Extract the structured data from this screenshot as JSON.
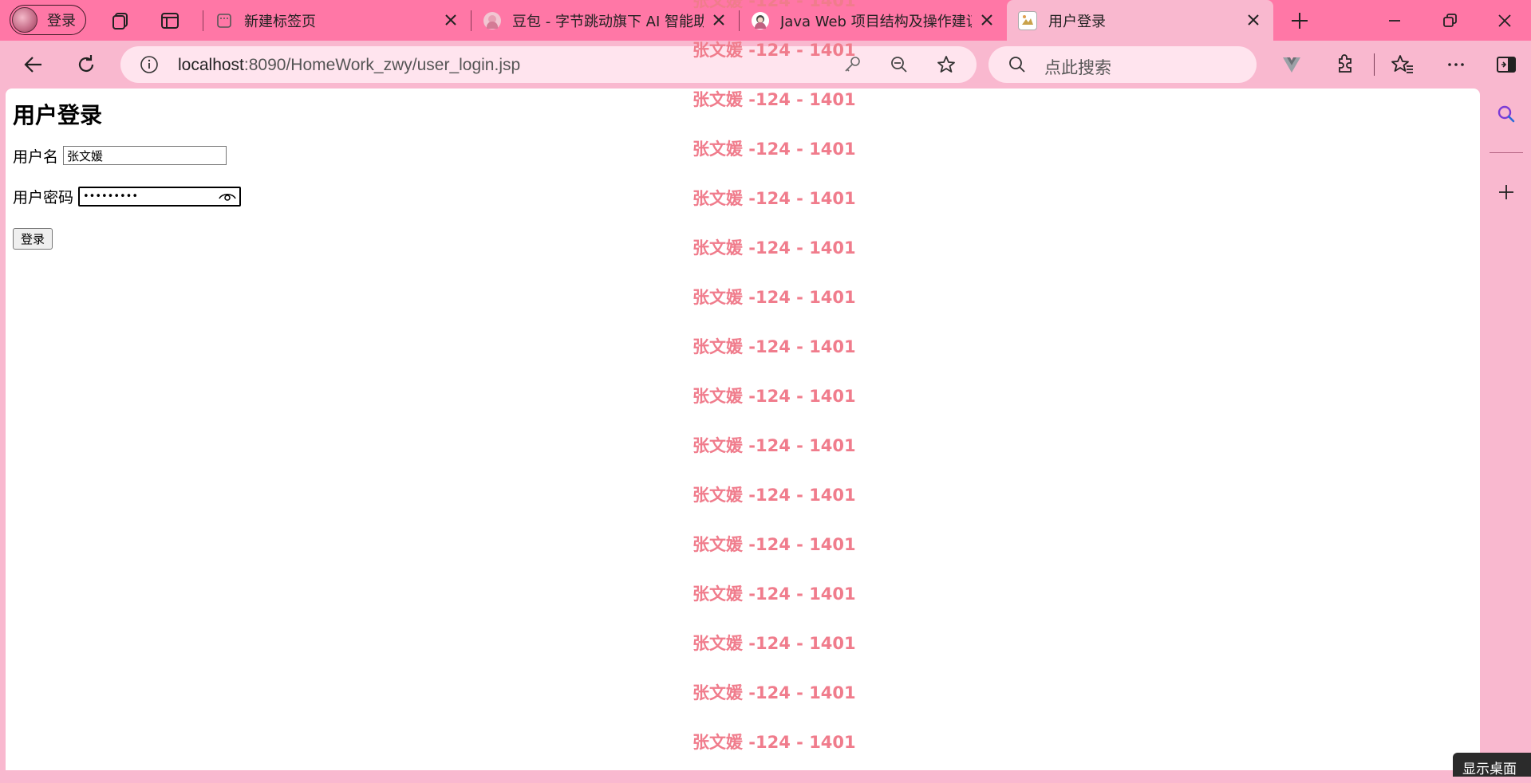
{
  "browser": {
    "profile_label": "登录",
    "tabs": [
      {
        "title": "新建标签页",
        "active": false
      },
      {
        "title": "豆包 - 字节跳动旗下 AI 智能助",
        "active": false
      },
      {
        "title": "Java Web 项目结构及操作建议",
        "active": false
      },
      {
        "title": "用户登录",
        "active": true
      }
    ],
    "address": {
      "host": "localhost",
      "rest": ":8090/HomeWork_zwy/user_login.jsp"
    },
    "search_placeholder": "点此搜索"
  },
  "page": {
    "title": "用户登录",
    "username_label": "用户名",
    "username_value": "张文媛",
    "password_label": "用户密码",
    "password_masked": "•••••••••",
    "login_button": "登录"
  },
  "watermark": {
    "text": "张文媛 -124 - 1401",
    "lines": [
      "张文媛 -124 - 1401",
      "张文媛 -124 - 1401",
      "张文媛 -124 - 1401",
      "张文媛 -124 - 1401",
      "张文媛 -124 - 1401",
      "张文媛 -124 - 1401",
      "张文媛 -124 - 1401",
      "张文媛 -124 - 1401",
      "张文媛 -124 - 1401",
      "张文媛 -124 - 1401",
      "张文媛 -124 - 1401",
      "张文媛 -124 - 1401",
      "张文媛 -124 - 1401",
      "张文媛 -124 - 1401",
      "张文媛 -124 - 1401",
      "张文媛 -124 - 1401"
    ]
  },
  "taskbar_tooltip": "显示桌面",
  "colors": {
    "tabstrip": "#ff77a6",
    "chrome": "#f9b8cf",
    "watermark": "#f07c8c"
  }
}
